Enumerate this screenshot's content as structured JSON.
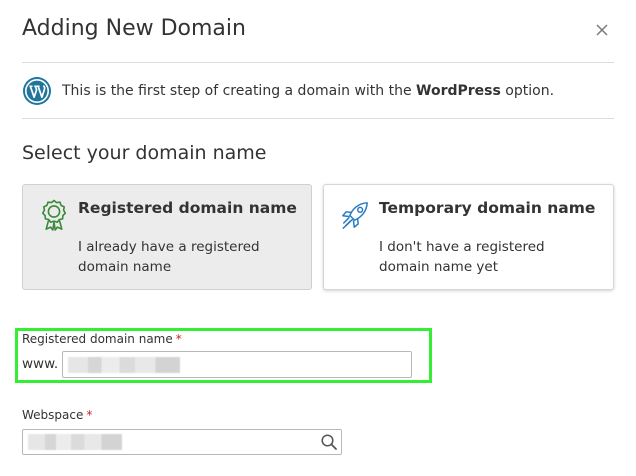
{
  "dialog": {
    "title": "Adding New Domain",
    "close_icon": "close-icon"
  },
  "info": {
    "icon": "wordpress-icon",
    "text_before": "This is the first step of creating a domain with the ",
    "text_bold": "WordPress",
    "text_after": " option."
  },
  "domain_choice": {
    "heading": "Select your domain name",
    "options": [
      {
        "icon": "award-ribbon-icon",
        "title": "Registered domain name",
        "description": "I already have a registered domain name",
        "selected": true
      },
      {
        "icon": "rocket-icon",
        "title": "Temporary domain name",
        "description": "I don't have a registered domain name yet",
        "selected": false
      }
    ]
  },
  "form": {
    "domain_label": "Registered domain name",
    "domain_prefix": "www.",
    "domain_value": "",
    "webspace_label": "Webspace",
    "webspace_value": "",
    "required_marker": "*",
    "search_icon": "search-icon"
  },
  "colors": {
    "highlight": "#33ee33",
    "required": "#d02020",
    "wordpress": "#21759b",
    "icon_green": "#3a8a3a",
    "icon_blue": "#2a7bc0"
  }
}
